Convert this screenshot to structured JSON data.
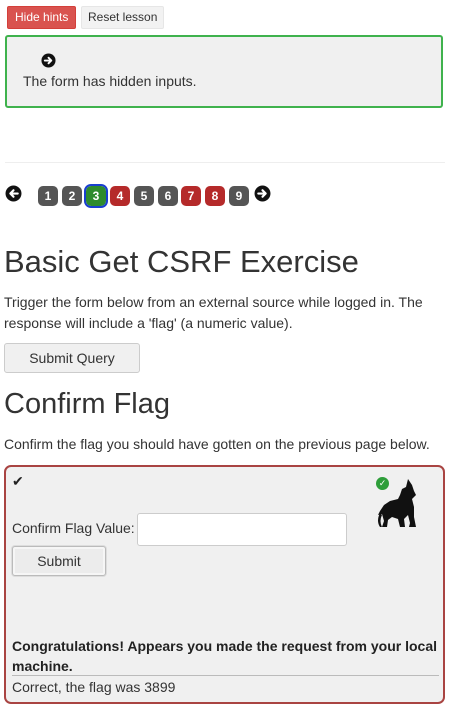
{
  "toolbar": {
    "hide_hints_label": "Hide hints",
    "reset_lesson_label": "Reset lesson"
  },
  "hint": {
    "text": "The form has hidden inputs.",
    "icon": "arrow-right-circle-icon"
  },
  "pagination": {
    "prev_icon": "arrow-left-circle-icon",
    "next_icon": "arrow-right-circle-icon",
    "pages": [
      {
        "label": "1",
        "status": "default"
      },
      {
        "label": "2",
        "status": "default"
      },
      {
        "label": "3",
        "status": "active"
      },
      {
        "label": "4",
        "status": "failed"
      },
      {
        "label": "5",
        "status": "default"
      },
      {
        "label": "6",
        "status": "default"
      },
      {
        "label": "7",
        "status": "failed"
      },
      {
        "label": "8",
        "status": "failed"
      },
      {
        "label": "9",
        "status": "default"
      }
    ]
  },
  "exercise": {
    "title": "Basic Get CSRF Exercise",
    "description": "Trigger the form below from an external source while logged in. The response will include a 'flag' (a numeric value).",
    "submit_query_label": "Submit Query"
  },
  "confirm": {
    "title": "Confirm Flag",
    "description": "Confirm the flag you should have gotten on the previous page below.",
    "check_icon": "checkmark-icon",
    "status_icon": "check-circle-icon",
    "mascot_icon": "wolf-icon",
    "flag_label": "Confirm Flag Value:",
    "flag_value": "",
    "submit_label": "Submit",
    "congrats_text": "Congratulations! Appears you made the request from your local machine.",
    "result_text": "Correct, the flag was 3899"
  },
  "colors": {
    "danger": "#d9534f",
    "success": "#3fb24d",
    "panel_border": "#a94442",
    "pill_default": "#555555",
    "pill_failed": "#b52a2a",
    "pill_active": "#2e8b2e"
  }
}
